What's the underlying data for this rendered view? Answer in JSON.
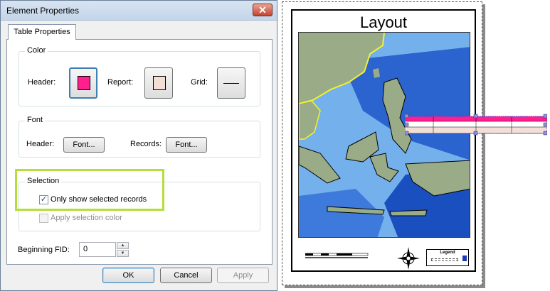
{
  "dialog": {
    "title": "Element Properties",
    "close_glyph": "✕",
    "tab_label": "Table Properties",
    "color_group": {
      "title": "Color",
      "header_label": "Header:",
      "report_label": "Report:",
      "grid_label": "Grid:",
      "header_color": "#ff1f8f",
      "report_color": "#f3dfd6",
      "grid_color": "#000000"
    },
    "font_group": {
      "title": "Font",
      "header_label": "Header:",
      "header_button": "Font...",
      "records_label": "Records:",
      "records_button": "Font..."
    },
    "selection_group": {
      "title": "Selection",
      "only_selected_label": "Only show selected records",
      "only_selected_checked": true,
      "apply_color_label": "Apply selection color",
      "apply_color_checked": false
    },
    "beginning_fid_label": "Beginning FID:",
    "beginning_fid_value": "0",
    "ok_button": "OK",
    "cancel_button": "Cancel",
    "apply_button": "Apply"
  },
  "layout": {
    "title": "Layout",
    "legend_title": "Legend",
    "legend_color": "#1b3dbd",
    "table_header_color": "#ff1f8f",
    "table_report_color": "#f3dfd6"
  },
  "icons": {
    "close": "close-icon",
    "checkmark": "checkmark-icon",
    "spin_up": "spin-up-icon",
    "spin_down": "spin-down-icon",
    "north_arrow": "north-arrow-icon"
  },
  "colors": {
    "highlight": "#b5dd3b",
    "ocean_deep": "#1a4fc0",
    "ocean_shallow": "#74b0ec",
    "land": "#9aab88",
    "coast_highlight": "#f3f32a"
  }
}
